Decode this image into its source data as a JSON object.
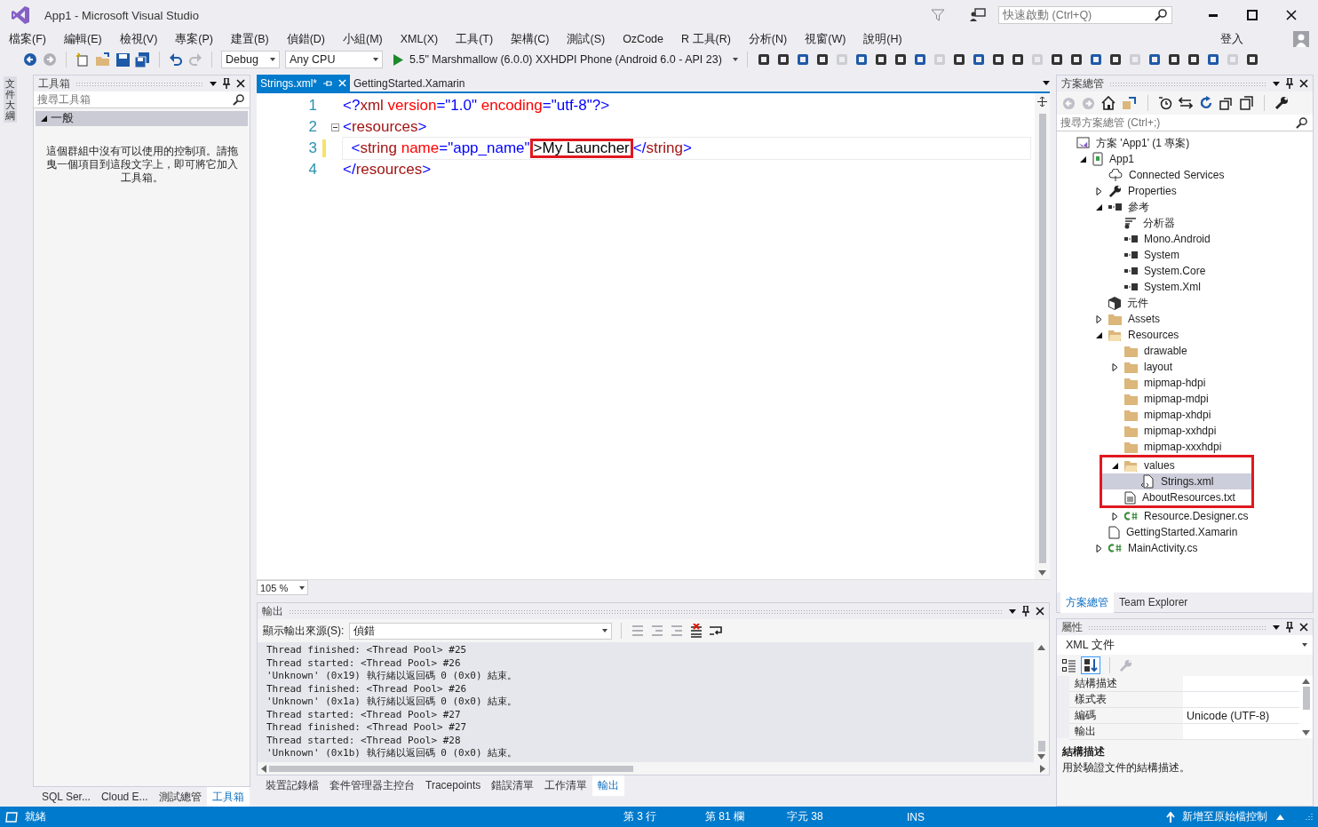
{
  "window": {
    "title": "App1 - Microsoft Visual Studio",
    "quick_launch": {
      "placeholder": "快速啟動 (Ctrl+Q)"
    }
  },
  "menu": [
    "檔案(F)",
    "編輯(E)",
    "檢視(V)",
    "專案(P)",
    "建置(B)",
    "偵錯(D)",
    "小組(M)",
    "XML(X)",
    "工具(T)",
    "架構(C)",
    "測試(S)",
    "OzCode",
    "R 工具(R)",
    "分析(N)",
    "視窗(W)",
    "說明(H)"
  ],
  "sign_in": "登入",
  "toolbar": {
    "configuration": "Debug",
    "platform": "Any CPU",
    "run_target": "5.5\" Marshmallow (6.0.0) XXHDPI Phone (Android 6.0 - API 23)"
  },
  "side_tab": "文件大綱",
  "toolbox": {
    "title": "工具箱",
    "search": {
      "placeholder": "搜尋工具箱"
    },
    "group": {
      "label": "一般",
      "expanded": true
    },
    "message": "這個群組中沒有可以使用的控制項。請拖曳一個項目到這段文字上，即可將它加入工具箱。",
    "tabs": [
      {
        "label": "SQL Ser...",
        "selected": false
      },
      {
        "label": "Cloud E...",
        "selected": false
      },
      {
        "label": "測試總管",
        "selected": false
      },
      {
        "label": "工具箱",
        "selected": true
      }
    ]
  },
  "editor": {
    "tabs": [
      {
        "label": "Strings.xml*",
        "selected": true
      },
      {
        "label": "GettingStarted.Xamarin",
        "selected": false
      }
    ],
    "lines": [
      {
        "number": "1",
        "current": false,
        "modified": false,
        "foldable": false,
        "tokens": [
          {
            "text": "<?",
            "kind": "punct",
            "boxed": false
          },
          {
            "text": "xml",
            "kind": "tag",
            "boxed": false
          },
          {
            "text": " version",
            "kind": "attr",
            "boxed": false
          },
          {
            "text": "=",
            "kind": "punct",
            "boxed": false
          },
          {
            "text": "\"1.0\"",
            "kind": "value",
            "boxed": false
          },
          {
            "text": " encoding",
            "kind": "attr",
            "boxed": false
          },
          {
            "text": "=",
            "kind": "punct",
            "boxed": false
          },
          {
            "text": "\"utf-8\"",
            "kind": "value",
            "boxed": false
          },
          {
            "text": "?>",
            "kind": "punct",
            "boxed": false
          }
        ]
      },
      {
        "number": "2",
        "current": false,
        "modified": false,
        "foldable": true,
        "tokens": [
          {
            "text": "<",
            "kind": "punct",
            "boxed": false
          },
          {
            "text": "resources",
            "kind": "tag",
            "boxed": false
          },
          {
            "text": ">",
            "kind": "punct",
            "boxed": false
          }
        ]
      },
      {
        "number": "3",
        "current": true,
        "modified": true,
        "foldable": false,
        "tokens": [
          {
            "text": "  <",
            "kind": "punct",
            "boxed": false
          },
          {
            "text": "string",
            "kind": "tag",
            "boxed": false
          },
          {
            "text": " name",
            "kind": "attr",
            "boxed": false
          },
          {
            "text": "=",
            "kind": "punct",
            "boxed": false
          },
          {
            "text": "\"app_name\"",
            "kind": "value",
            "boxed": false
          },
          {
            "text": ">My Launcher",
            "kind": "text",
            "boxed": true
          },
          {
            "text": "</",
            "kind": "punct",
            "boxed": false
          },
          {
            "text": "string",
            "kind": "tag",
            "boxed": false
          },
          {
            "text": ">",
            "kind": "punct",
            "boxed": false
          }
        ]
      },
      {
        "number": "4",
        "current": false,
        "modified": false,
        "foldable": false,
        "tokens": [
          {
            "text": "</",
            "kind": "punct",
            "boxed": false
          },
          {
            "text": "resources",
            "kind": "tag",
            "boxed": false
          },
          {
            "text": ">",
            "kind": "punct",
            "boxed": false
          }
        ]
      }
    ],
    "zoom": "105 %"
  },
  "output": {
    "title": "輸出",
    "source_label": "顯示輸出來源(S):",
    "source": "偵錯",
    "lines": [
      "Thread finished: <Thread Pool> #25",
      "Thread started: <Thread Pool> #26",
      "'Unknown' (0x19) 執行緒以返回碼 0 (0x0) 結束。",
      "Thread finished: <Thread Pool> #26",
      "'Unknown' (0x1a) 執行緒以返回碼 0 (0x0) 結束。",
      "Thread started: <Thread Pool> #27",
      "Thread finished: <Thread Pool> #27",
      "Thread started: <Thread Pool> #28",
      "'Unknown' (0x1b) 執行緒以返回碼 0 (0x0) 結束。"
    ],
    "tabs": [
      {
        "label": "裝置記錄檔",
        "selected": false
      },
      {
        "label": "套件管理器主控台",
        "selected": false
      },
      {
        "label": "Tracepoints",
        "selected": false
      },
      {
        "label": "錯誤清單",
        "selected": false
      },
      {
        "label": "工作清單",
        "selected": false
      },
      {
        "label": "輸出",
        "selected": true
      }
    ]
  },
  "solution_explorer": {
    "title": "方案總管",
    "search": {
      "placeholder": "搜尋方案總管 (Ctrl+;)"
    },
    "tree": [
      {
        "label": "方案 'App1' (1 專案)",
        "kind": "solution",
        "selected": false,
        "boxed": false,
        "children": [
          {
            "label": "App1",
            "kind": "project",
            "expanded": true,
            "selected": false,
            "boxed": false,
            "children": [
              {
                "label": "Connected Services",
                "kind": "service",
                "selected": false,
                "boxed": false
              },
              {
                "label": "Properties",
                "kind": "properties",
                "expanded": false,
                "selected": false,
                "boxed": false
              },
              {
                "label": "參考",
                "kind": "reference",
                "expanded": true,
                "selected": false,
                "boxed": false,
                "children": [
                  {
                    "label": "分析器",
                    "kind": "analyzer",
                    "selected": false,
                    "boxed": false
                  },
                  {
                    "label": "Mono.Android",
                    "kind": "reference",
                    "selected": false,
                    "boxed": false
                  },
                  {
                    "label": "System",
                    "kind": "reference",
                    "selected": false,
                    "boxed": false
                  },
                  {
                    "label": "System.Core",
                    "kind": "reference",
                    "selected": false,
                    "boxed": false
                  },
                  {
                    "label": "System.Xml",
                    "kind": "reference",
                    "selected": false,
                    "boxed": false
                  }
                ]
              },
              {
                "label": "元件",
                "kind": "component",
                "selected": false,
                "boxed": false
              },
              {
                "label": "Assets",
                "kind": "folder",
                "expanded": false,
                "selected": false,
                "boxed": false
              },
              {
                "label": "Resources",
                "kind": "folder",
                "expanded": true,
                "selected": false,
                "boxed": false,
                "children": [
                  {
                    "label": "drawable",
                    "kind": "folder",
                    "selected": false,
                    "boxed": false
                  },
                  {
                    "label": "layout",
                    "kind": "folder",
                    "expanded": false,
                    "selected": false,
                    "boxed": false
                  },
                  {
                    "label": "mipmap-hdpi",
                    "kind": "folder",
                    "selected": false,
                    "boxed": false
                  },
                  {
                    "label": "mipmap-mdpi",
                    "kind": "folder",
                    "selected": false,
                    "boxed": false
                  },
                  {
                    "label": "mipmap-xhdpi",
                    "kind": "folder",
                    "selected": false,
                    "boxed": false
                  },
                  {
                    "label": "mipmap-xxhdpi",
                    "kind": "folder",
                    "selected": false,
                    "boxed": false
                  },
                  {
                    "label": "mipmap-xxxhdpi",
                    "kind": "folder",
                    "selected": false,
                    "boxed": false
                  },
                  {
                    "label": "values",
                    "kind": "folder",
                    "expanded": true,
                    "selected": false,
                    "boxed": true,
                    "children": [
                      {
                        "label": "Strings.xml",
                        "kind": "xml",
                        "selected": true,
                        "boxed": true
                      }
                    ]
                  },
                  {
                    "label": "AboutResources.txt",
                    "kind": "text",
                    "selected": false,
                    "boxed": true
                  },
                  {
                    "label": "Resource.Designer.cs",
                    "kind": "csharp",
                    "expanded": false,
                    "selected": false,
                    "boxed": false
                  }
                ]
              },
              {
                "label": "GettingStarted.Xamarin",
                "kind": "file",
                "selected": false,
                "boxed": false
              },
              {
                "label": "MainActivity.cs",
                "kind": "csharp",
                "expanded": false,
                "selected": false,
                "boxed": false
              }
            ]
          }
        ]
      }
    ],
    "tabs": [
      {
        "label": "方案總管",
        "selected": true
      },
      {
        "label": "Team Explorer",
        "selected": false
      }
    ]
  },
  "properties": {
    "title": "屬性",
    "object": "XML 文件",
    "rows": [
      {
        "name": "結構描述",
        "value": ""
      },
      {
        "name": "樣式表",
        "value": ""
      },
      {
        "name": "編碼",
        "value": "Unicode (UTF-8)"
      },
      {
        "name": "輸出",
        "value": ""
      }
    ],
    "description_title": "結構描述",
    "description": "用於驗證文件的結構描述。"
  },
  "status_bar": {
    "state": "就緒",
    "line": "第 3 行",
    "column": "第 81 欄",
    "char": "字元 38",
    "mode": "INS",
    "source_control": "新增至原始檔控制"
  }
}
